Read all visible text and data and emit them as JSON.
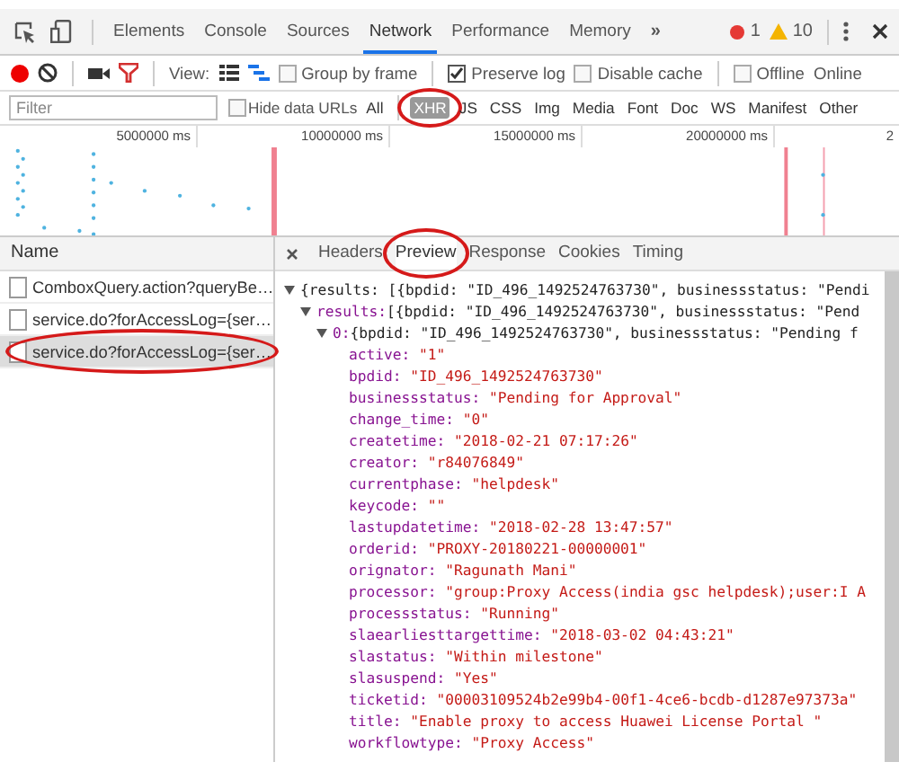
{
  "devtools_tabs": [
    {
      "label": "Elements",
      "selected": false
    },
    {
      "label": "Console",
      "selected": false
    },
    {
      "label": "Sources",
      "selected": false
    },
    {
      "label": "Network",
      "selected": true
    },
    {
      "label": "Performance",
      "selected": false
    },
    {
      "label": "Memory",
      "selected": false
    }
  ],
  "more_tabs": "»",
  "error_count": "1",
  "warning_count": "10",
  "toolbar": {
    "recording": true,
    "view_label": "View:",
    "checkboxes": [
      {
        "label": "Group by frame",
        "checked": false
      },
      {
        "label": "Preserve log",
        "checked": true
      },
      {
        "label": "Disable cache",
        "checked": false
      },
      {
        "label": "Offline",
        "checked": false
      }
    ],
    "throttling": "Online"
  },
  "filter": {
    "placeholder": "Filter",
    "hide_data_urls": {
      "label": "Hide data URLs",
      "checked": false
    },
    "types": [
      {
        "label": "All",
        "selected": false,
        "circled": false
      },
      {
        "label": "XHR",
        "selected": true,
        "circled": true
      },
      {
        "label": "JS",
        "selected": false,
        "circled": false
      },
      {
        "label": "CSS",
        "selected": false,
        "circled": false
      },
      {
        "label": "Img",
        "selected": false,
        "circled": false
      },
      {
        "label": "Media",
        "selected": false,
        "circled": false
      },
      {
        "label": "Font",
        "selected": false,
        "circled": false
      },
      {
        "label": "Doc",
        "selected": false,
        "circled": false
      },
      {
        "label": "WS",
        "selected": false,
        "circled": false
      },
      {
        "label": "Manifest",
        "selected": false,
        "circled": false
      },
      {
        "label": "Other",
        "selected": false,
        "circled": false
      }
    ]
  },
  "timeline": {
    "ticks": [
      "5000000 ms",
      "10000000 ms",
      "15000000 ms",
      "20000000 ms",
      "2"
    ]
  },
  "requests": {
    "header": "Name",
    "items": [
      {
        "name": "ComboxQuery.action?queryBe…",
        "selected": false,
        "circled": false
      },
      {
        "name": "service.do?forAccessLog={ser…",
        "selected": false,
        "circled": false
      },
      {
        "name": "service.do?forAccessLog={ser…",
        "selected": true,
        "circled": true
      }
    ]
  },
  "detail_tabs": [
    {
      "label": "Headers",
      "selected": false,
      "circled": false
    },
    {
      "label": "Preview",
      "selected": true,
      "circled": true
    },
    {
      "label": "Response",
      "selected": false,
      "circled": false
    },
    {
      "label": "Cookies",
      "selected": false,
      "circled": false
    },
    {
      "label": "Timing",
      "selected": false,
      "circled": false
    }
  ],
  "preview": {
    "tree": [
      {
        "summary": "{results: [{bpdid: \"ID_496_1492524763730\", businessstatus: \"Pendi",
        "expanded": true,
        "children": [
          {
            "key": "results:",
            "summary": "[{bpdid: \"ID_496_1492524763730\", businessstatus: \"Pend",
            "expanded": true,
            "children": [
              {
                "key": "0:",
                "summary": "{bpdid: \"ID_496_1492524763730\", businessstatus: \"Pending f",
                "expanded": true,
                "children": [
                  {
                    "key": "active:",
                    "value": "\"1\""
                  },
                  {
                    "key": "bpdid:",
                    "value": "\"ID_496_1492524763730\""
                  },
                  {
                    "key": "businessstatus:",
                    "value": "\"Pending for Approval\""
                  },
                  {
                    "key": "change_time:",
                    "value": "\"0\""
                  },
                  {
                    "key": "createtime:",
                    "value": "\"2018-02-21 07:17:26\""
                  },
                  {
                    "key": "creator:",
                    "value": "\"r84076849\""
                  },
                  {
                    "key": "currentphase:",
                    "value": "\"helpdesk\""
                  },
                  {
                    "key": "keycode:",
                    "value": "\"\""
                  },
                  {
                    "key": "lastupdatetime:",
                    "value": "\"2018-02-28 13:47:57\""
                  },
                  {
                    "key": "orderid:",
                    "value": "\"PROXY-20180221-00000001\""
                  },
                  {
                    "key": "orignator:",
                    "value": "\"Ragunath Mani\""
                  },
                  {
                    "key": "processor:",
                    "value": "\"group:Proxy Access(india gsc helpdesk);user:I A"
                  },
                  {
                    "key": "processstatus:",
                    "value": "\"Running\""
                  },
                  {
                    "key": "slaearliesttargettime:",
                    "value": "\"2018-03-02 04:43:21\""
                  },
                  {
                    "key": "slastatus:",
                    "value": "\"Within milestone\""
                  },
                  {
                    "key": "slasuspend:",
                    "value": "\"Yes\""
                  },
                  {
                    "key": "ticketid:",
                    "value": "\"00003109524b2e99b4-00f1-4ce6-bcdb-d1287e97373a\""
                  },
                  {
                    "key": "title:",
                    "value": "\"Enable proxy to access Huawei License Portal \""
                  },
                  {
                    "key": "workflowtype:",
                    "value": "\"Proxy Access\""
                  }
                ]
              }
            ]
          }
        ]
      }
    ]
  }
}
